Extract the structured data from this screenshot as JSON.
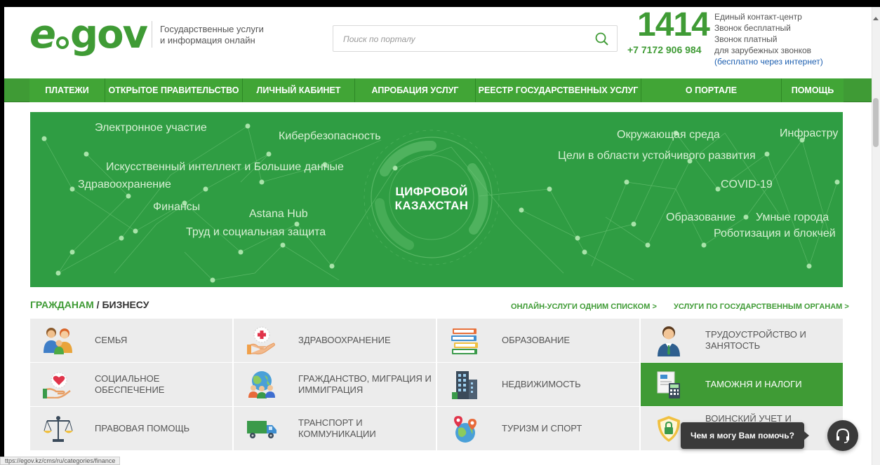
{
  "header": {
    "logo_text": "egov",
    "tagline_line1": "Государственные услуги",
    "tagline_line2": "и информация онлайн",
    "search_placeholder": "Поиск по порталу",
    "phone_short": "1414",
    "phone_full": "+7 7172 906 984",
    "contact_lines": [
      "Единый контакт-центр",
      "Звонок бесплатный",
      "Звонок платный",
      "для зарубежных звонков"
    ],
    "contact_link": "(бесплатно через интернет)"
  },
  "nav": {
    "items": [
      "Платежи",
      "Открытое правительство",
      "Личный кабинет",
      "Апробация услуг",
      "Реестр государственных услуг",
      "О портале",
      "Помощь"
    ]
  },
  "banner": {
    "center_line1": "ЦИФРОВОЙ",
    "center_line2": "КАЗАХСТАН",
    "words": [
      "Электронное участие",
      "Кибербезопасность",
      "Искусственный интеллект и Большие данные",
      "Здравоохранение",
      "Финансы",
      "Astana Hub",
      "Труд и социальная защита",
      "Окружающая среда",
      "Инфрастру",
      "Цели в области устойчивого развития",
      "COVID-19",
      "Образование",
      "Умные города",
      "Роботизация и блокчей"
    ]
  },
  "section": {
    "title_citizens": "ГРАЖДАНАМ",
    "title_sep": " / ",
    "title_business": "БИЗНЕСУ",
    "link_online": "ОНЛАЙН-УСЛУГИ ОДНИМ СПИСКОМ >",
    "link_agencies": "УСЛУГИ ПО ГОСУДАРСТВЕННЫМ ОРГАНАМ >"
  },
  "categories": [
    {
      "label": "Семья",
      "icon": "family-icon"
    },
    {
      "label": "Здравоохранение",
      "icon": "healthcare-icon"
    },
    {
      "label": "Образование",
      "icon": "books-icon"
    },
    {
      "label": "Трудоустройство и занятость",
      "icon": "worker-icon"
    },
    {
      "label": "Социальное обеспечение",
      "icon": "heart-hand-icon"
    },
    {
      "label": "Гражданство, миграция и иммиграция",
      "icon": "globe-people-icon"
    },
    {
      "label": "Недвижимость",
      "icon": "building-icon"
    },
    {
      "label": "Таможня и налоги",
      "icon": "calculator-icon"
    },
    {
      "label": "Правовая помощь",
      "icon": "scales-icon"
    },
    {
      "label": "Транспорт и коммуникации",
      "icon": "truck-icon"
    },
    {
      "label": "Туризм и спорт",
      "icon": "globe-pin-icon"
    },
    {
      "label": "Воинский учет и",
      "icon": "shield-lock-icon"
    }
  ],
  "chat": {
    "bubble_text": "Чем я могу Вам помочь?"
  },
  "status_bar": {
    "url": "ttps://egov.kz/cms/ru/categories/finance"
  },
  "colors": {
    "brand_green": "#3f9b35",
    "banner_green": "#2f9d43",
    "link_blue": "#1d5fb0"
  }
}
